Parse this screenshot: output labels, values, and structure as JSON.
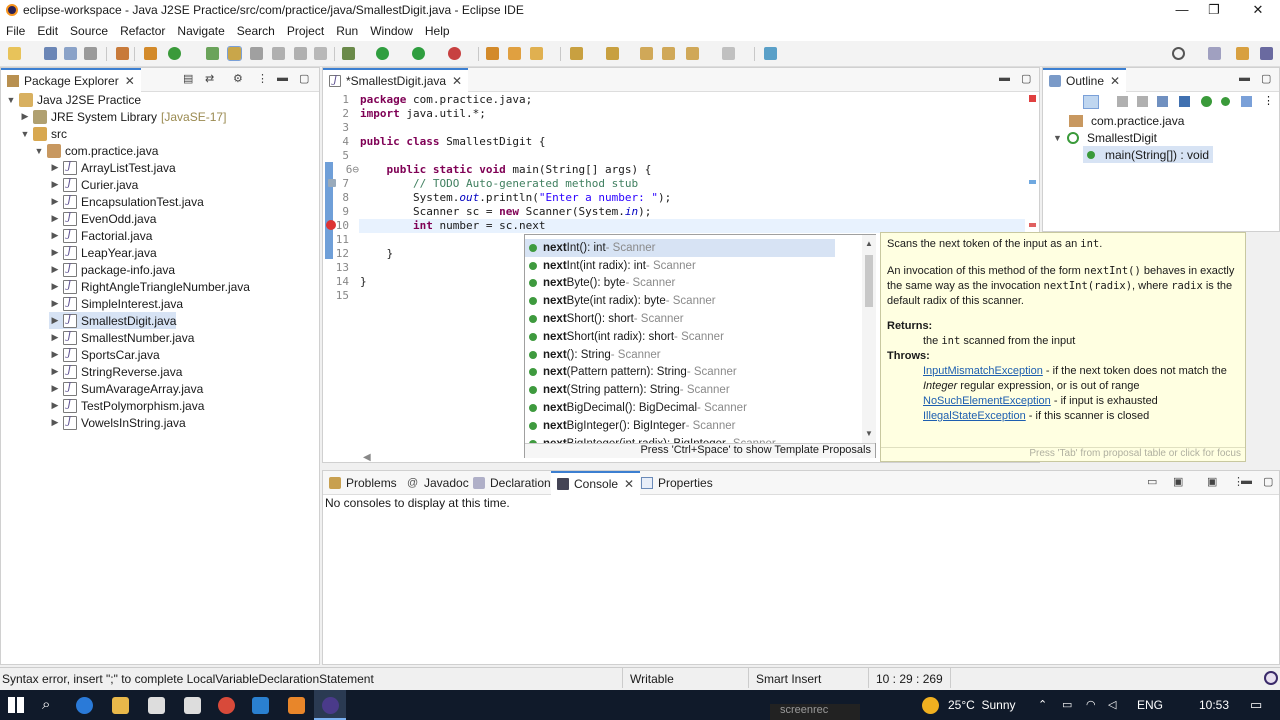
{
  "window": {
    "title": "eclipse-workspace - Java J2SE Practice/src/com/practice/java/SmallestDigit.java - Eclipse IDE",
    "minimize": "—",
    "maximize": "❐",
    "close": "✕"
  },
  "menu": [
    "File",
    "Edit",
    "Source",
    "Refactor",
    "Navigate",
    "Search",
    "Project",
    "Run",
    "Window",
    "Help"
  ],
  "package_explorer": {
    "tab_label": "Package Explorer",
    "project": "Java J2SE Practice",
    "jre": "JRE System Library",
    "jre_version": "[JavaSE-17]",
    "src": "src",
    "package": "com.practice.java",
    "files": [
      "ArrayListTest.java",
      "Curier.java",
      "EncapsulationTest.java",
      "EvenOdd.java",
      "Factorial.java",
      "LeapYear.java",
      "package-info.java",
      "RightAngleTriangleNumber.java",
      "SimpleInterest.java",
      "SmallestDigit.java",
      "SmallestNumber.java",
      "SportsCar.java",
      "StringReverse.java",
      "SumAvarageArray.java",
      "TestPolymorphism.java",
      "VowelsInString.java"
    ],
    "selected_file": "SmallestDigit.java"
  },
  "editor": {
    "tab_label": "*SmallestDigit.java",
    "line_numbers": [
      "1",
      "2",
      "3",
      "4",
      "5",
      "6⊖",
      "7",
      "8",
      "9",
      "10",
      "11",
      "12",
      "13",
      "14",
      "15"
    ],
    "code": {
      "l1_kw": "package",
      "l1_rest": " com.practice.java;",
      "l2_kw": "import",
      "l2_rest": " java.util.*;",
      "l4_kw": "public class",
      "l4_rest": " SmallestDigit {",
      "l6_kw": "    public static void",
      "l6_rest": " main(String[] args) {",
      "l7": "        // TODO Auto-generated method stub",
      "l8_a": "        System.",
      "l8_fld": "out",
      "l8_b": ".println(",
      "l8_str": "\"Enter a number: \"",
      "l8_c": ");",
      "l9_a": "        Scanner sc = ",
      "l9_kw": "new",
      "l9_b": " Scanner(System.",
      "l9_fld": "in",
      "l9_c": ");",
      "l10_kw": "        int",
      "l10_rest": " number = sc.next",
      "l12": "    }",
      "l14": "}"
    }
  },
  "content_assist": {
    "proposals": [
      {
        "bold": "next",
        "name": "Int()",
        "type": " : int",
        "owner": " - Scanner"
      },
      {
        "bold": "next",
        "name": "Int(int radix)",
        "type": " : int",
        "owner": " - Scanner"
      },
      {
        "bold": "next",
        "name": "Byte()",
        "type": " : byte",
        "owner": " - Scanner"
      },
      {
        "bold": "next",
        "name": "Byte(int radix)",
        "type": " : byte",
        "owner": " - Scanner"
      },
      {
        "bold": "next",
        "name": "Short()",
        "type": " : short",
        "owner": " - Scanner"
      },
      {
        "bold": "next",
        "name": "Short(int radix)",
        "type": " : short",
        "owner": " - Scanner"
      },
      {
        "bold": "next",
        "name": "()",
        "type": " : String",
        "owner": " - Scanner"
      },
      {
        "bold": "next",
        "name": "(Pattern pattern)",
        "type": " : String",
        "owner": " - Scanner"
      },
      {
        "bold": "next",
        "name": "(String pattern)",
        "type": " : String",
        "owner": " - Scanner"
      },
      {
        "bold": "next",
        "name": "BigDecimal()",
        "type": " : BigDecimal",
        "owner": " - Scanner"
      },
      {
        "bold": "next",
        "name": "BigInteger()",
        "type": " : BigInteger",
        "owner": " - Scanner"
      },
      {
        "bold": "next",
        "name": "BigInteger(int radix)",
        "type": " : BigInteger",
        "owner": " - Scanner"
      }
    ],
    "footer": "Press 'Ctrl+Space' to show Template Proposals"
  },
  "javadoc": {
    "p1_a": "Scans the next token of the input as an ",
    "p1_code": "int",
    "p1_b": ".",
    "p2_a": "An invocation of this method of the form ",
    "p2_code1": "nextInt()",
    "p2_b": " behaves in exactly the same way as the invocation ",
    "p2_code2": "nextInt(radix)",
    "p2_c": ", where ",
    "p2_code3": "radix",
    "p2_d": " is the default radix of this scanner.",
    "returns_label": "Returns:",
    "returns_a": "the ",
    "returns_code": "int",
    "returns_b": " scanned from the input",
    "throws_label": "Throws:",
    "t1_link": "InputMismatchException",
    "t1_a": " - if the next token does not match the ",
    "t1_em": "Integer",
    "t1_b": " regular expression, or is out of range",
    "t2_link": "NoSuchElementException",
    "t2_a": " - if input is exhausted",
    "t3_link": "IllegalStateException",
    "t3_a": " - if this scanner is closed",
    "footer": "Press 'Tab' from proposal table or click for focus"
  },
  "outline": {
    "tab_label": "Outline",
    "package": "com.practice.java",
    "class": "SmallestDigit",
    "method": "main(String[]) : void"
  },
  "bottom_panel": {
    "tabs": [
      "Problems",
      "Javadoc",
      "Declaration",
      "Console",
      "Properties"
    ],
    "active_tab": "Console",
    "message": "No consoles to display at this time."
  },
  "status": {
    "error": "Syntax error, insert \";\" to complete LocalVariableDeclarationStatement",
    "writable": "Writable",
    "insert_mode": "Smart Insert",
    "position": "10 : 29 : 269"
  },
  "taskbar": {
    "weather": "25°C  Sunny",
    "lang": "ENG",
    "time": "10:53",
    "watermark": "screenrec"
  },
  "colors": {
    "accent": "#3c7fd1",
    "keyword": "#7f0055",
    "comment": "#3f7f5f",
    "string": "#2a00ff",
    "selection": "#d7e3f4",
    "tooltip_bg": "#ffffe1",
    "taskbar": "#101a2a"
  }
}
